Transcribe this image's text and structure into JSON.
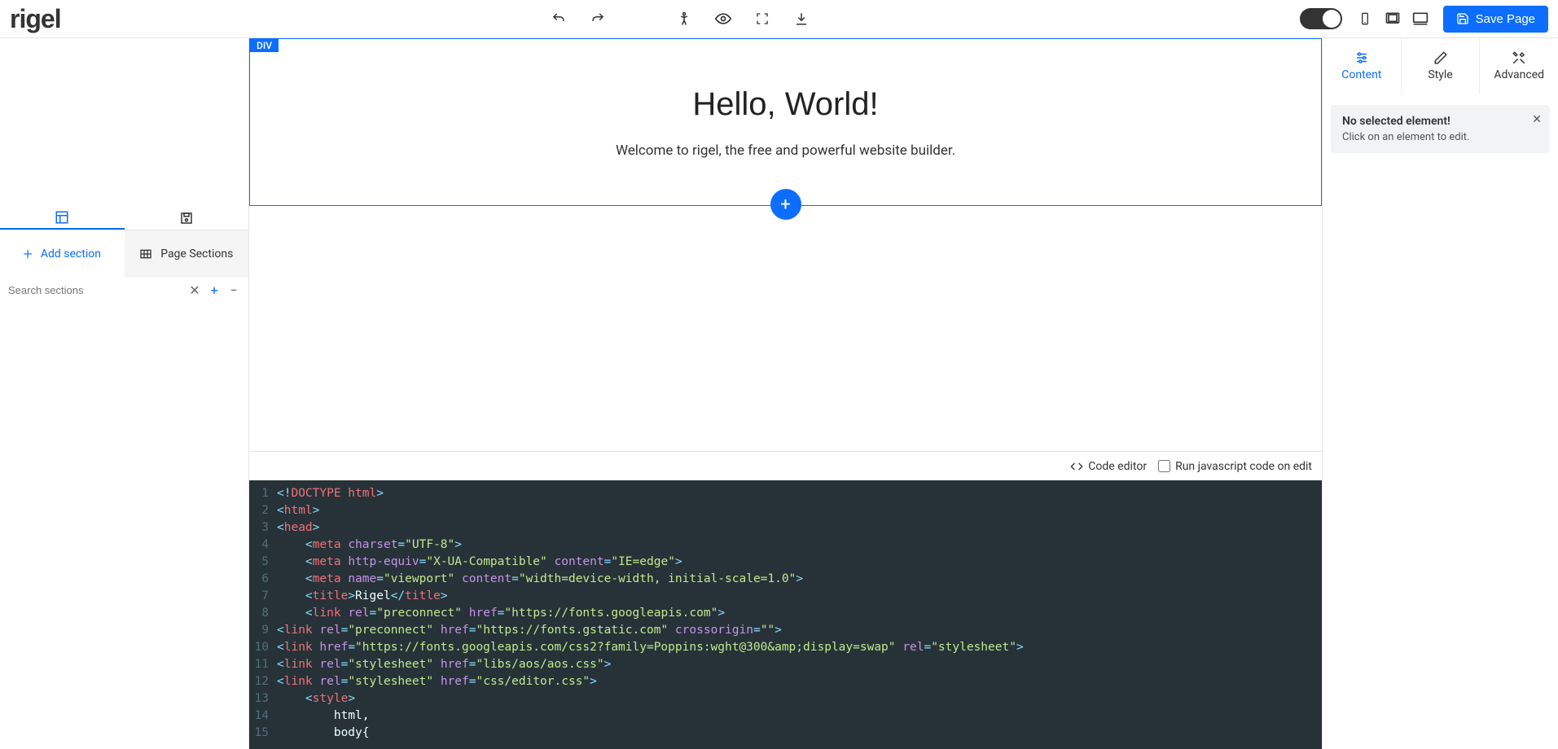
{
  "logo": "rigel",
  "toolbar": {
    "save_label": "Save Page"
  },
  "leftPanel": {
    "addSection": "Add section",
    "pageSections": "Page Sections",
    "searchPlaceholder": "Search sections"
  },
  "canvas": {
    "selectedTag": "DIV",
    "heading": "Hello, World!",
    "subheading": "Welcome to rigel, the free and powerful website builder."
  },
  "codeBar": {
    "label": "Code editor",
    "runLabel": "Run javascript code on edit"
  },
  "rightPanel": {
    "tabs": {
      "content": "Content",
      "style": "Style",
      "advanced": "Advanced"
    },
    "message": {
      "title": "No selected element!",
      "body": "Click on an element to edit."
    }
  },
  "code": {
    "lines": [
      [
        [
          "punct",
          "<!"
        ],
        [
          "tag",
          "DOCTYPE html"
        ],
        [
          "punct",
          ">"
        ]
      ],
      [
        [
          "punct",
          "<"
        ],
        [
          "tag",
          "html"
        ],
        [
          "punct",
          ">"
        ]
      ],
      [
        [
          "punct",
          "<"
        ],
        [
          "tag",
          "head"
        ],
        [
          "punct",
          ">"
        ]
      ],
      [
        [
          "plain",
          "    "
        ],
        [
          "punct",
          "<"
        ],
        [
          "tag",
          "meta"
        ],
        [
          "plain",
          " "
        ],
        [
          "attr",
          "charset"
        ],
        [
          "punct",
          "="
        ],
        [
          "str",
          "\"UTF-8\""
        ],
        [
          "punct",
          ">"
        ]
      ],
      [
        [
          "plain",
          "    "
        ],
        [
          "punct",
          "<"
        ],
        [
          "tag",
          "meta"
        ],
        [
          "plain",
          " "
        ],
        [
          "attr",
          "http-equiv"
        ],
        [
          "punct",
          "="
        ],
        [
          "str",
          "\"X-UA-Compatible\""
        ],
        [
          "plain",
          " "
        ],
        [
          "attr",
          "content"
        ],
        [
          "punct",
          "="
        ],
        [
          "str",
          "\"IE=edge\""
        ],
        [
          "punct",
          ">"
        ]
      ],
      [
        [
          "plain",
          "    "
        ],
        [
          "punct",
          "<"
        ],
        [
          "tag",
          "meta"
        ],
        [
          "plain",
          " "
        ],
        [
          "attr",
          "name"
        ],
        [
          "punct",
          "="
        ],
        [
          "str",
          "\"viewport\""
        ],
        [
          "plain",
          " "
        ],
        [
          "attr",
          "content"
        ],
        [
          "punct",
          "="
        ],
        [
          "str",
          "\"width=device-width, initial-scale=1.0\""
        ],
        [
          "punct",
          ">"
        ]
      ],
      [
        [
          "plain",
          "    "
        ],
        [
          "punct",
          "<"
        ],
        [
          "tag",
          "title"
        ],
        [
          "punct",
          ">"
        ],
        [
          "plain",
          "Rigel"
        ],
        [
          "punct",
          "</"
        ],
        [
          "tag",
          "title"
        ],
        [
          "punct",
          ">"
        ]
      ],
      [
        [
          "plain",
          "    "
        ],
        [
          "punct",
          "<"
        ],
        [
          "tag",
          "link"
        ],
        [
          "plain",
          " "
        ],
        [
          "attr",
          "rel"
        ],
        [
          "punct",
          "="
        ],
        [
          "str",
          "\"preconnect\""
        ],
        [
          "plain",
          " "
        ],
        [
          "attr",
          "href"
        ],
        [
          "punct",
          "="
        ],
        [
          "str",
          "\"https://fonts.googleapis.com\""
        ],
        [
          "punct",
          ">"
        ]
      ],
      [
        [
          "punct",
          "<"
        ],
        [
          "tag",
          "link"
        ],
        [
          "plain",
          " "
        ],
        [
          "attr",
          "rel"
        ],
        [
          "punct",
          "="
        ],
        [
          "str",
          "\"preconnect\""
        ],
        [
          "plain",
          " "
        ],
        [
          "attr",
          "href"
        ],
        [
          "punct",
          "="
        ],
        [
          "str",
          "\"https://fonts.gstatic.com\""
        ],
        [
          "plain",
          " "
        ],
        [
          "attr",
          "crossorigin"
        ],
        [
          "punct",
          "="
        ],
        [
          "str",
          "\"\""
        ],
        [
          "punct",
          ">"
        ]
      ],
      [
        [
          "punct",
          "<"
        ],
        [
          "tag",
          "link"
        ],
        [
          "plain",
          " "
        ],
        [
          "attr",
          "href"
        ],
        [
          "punct",
          "="
        ],
        [
          "str",
          "\"https://fonts.googleapis.com/css2?family=Poppins:wght@300&amp;display=swap\""
        ],
        [
          "plain",
          " "
        ],
        [
          "attr",
          "rel"
        ],
        [
          "punct",
          "="
        ],
        [
          "str",
          "\"stylesheet\""
        ],
        [
          "punct",
          ">"
        ]
      ],
      [
        [
          "punct",
          "<"
        ],
        [
          "tag",
          "link"
        ],
        [
          "plain",
          " "
        ],
        [
          "attr",
          "rel"
        ],
        [
          "punct",
          "="
        ],
        [
          "str",
          "\"stylesheet\""
        ],
        [
          "plain",
          " "
        ],
        [
          "attr",
          "href"
        ],
        [
          "punct",
          "="
        ],
        [
          "str",
          "\"libs/aos/aos.css\""
        ],
        [
          "punct",
          ">"
        ]
      ],
      [
        [
          "punct",
          "<"
        ],
        [
          "tag",
          "link"
        ],
        [
          "plain",
          " "
        ],
        [
          "attr",
          "rel"
        ],
        [
          "punct",
          "="
        ],
        [
          "str",
          "\"stylesheet\""
        ],
        [
          "plain",
          " "
        ],
        [
          "attr",
          "href"
        ],
        [
          "punct",
          "="
        ],
        [
          "str",
          "\"css/editor.css\""
        ],
        [
          "punct",
          ">"
        ]
      ],
      [
        [
          "plain",
          "    "
        ],
        [
          "punct",
          "<"
        ],
        [
          "tag",
          "style"
        ],
        [
          "punct",
          ">"
        ]
      ],
      [
        [
          "plain",
          "        html,"
        ]
      ],
      [
        [
          "plain",
          "        body{"
        ]
      ]
    ]
  }
}
